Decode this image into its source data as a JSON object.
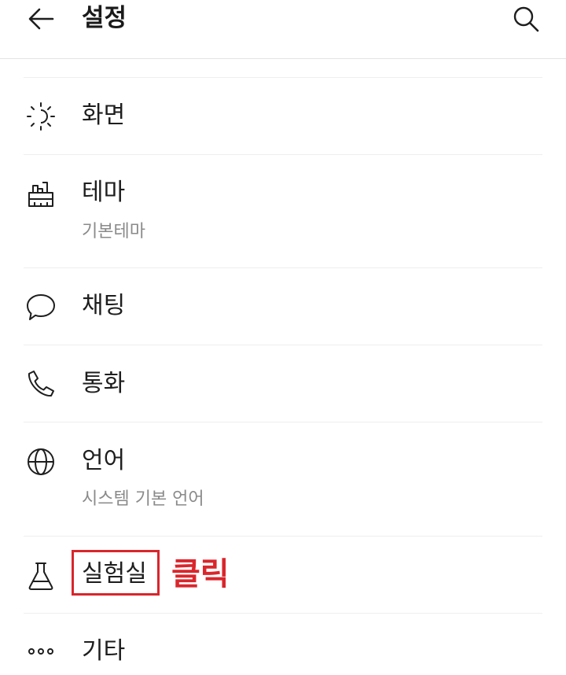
{
  "header": {
    "title": "설정",
    "back_icon": "arrow-left-icon",
    "search_icon": "search-icon"
  },
  "items": [
    {
      "label": "화면",
      "icon": "brightness-icon"
    },
    {
      "label": "테마",
      "sub": "기본테마",
      "icon": "paintbrush-icon"
    },
    {
      "label": "채팅",
      "icon": "chat-bubble-icon"
    },
    {
      "label": "통화",
      "icon": "phone-icon"
    },
    {
      "label": "언어",
      "sub": "시스템 기본 언어",
      "icon": "globe-icon"
    },
    {
      "label": "실험실",
      "icon": "flask-icon"
    },
    {
      "label": "기타",
      "icon": "more-dots-icon"
    }
  ],
  "annotation": {
    "text": "클릭",
    "color": "#d9262c"
  }
}
